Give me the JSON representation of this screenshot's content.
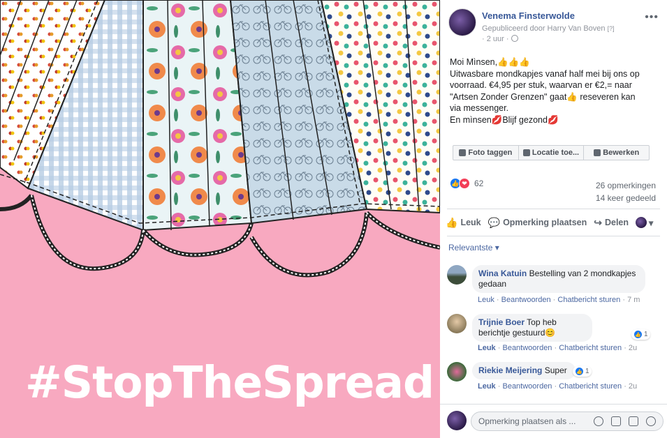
{
  "photo": {
    "hashtag": "#StopTheSpread",
    "background_color": "#f8a9c0"
  },
  "post": {
    "page_name": "Venema Finsterwolde",
    "published_by": "Gepubliceerd door Harry Van Boven",
    "help": "[?]",
    "time": "2 uur",
    "privacy_icon": "globe-icon",
    "text_lines": [
      "Moi Mìnsen,👍👍👍",
      "Uitwasbare mondkapjes vanaf half mei bij ons op",
      "voorraad. €4,95 per stuk, waarvan er €2,= naar",
      "\"Artsen Zonder Grenzen\" gaat👍 reseveren kan",
      "via messenger.",
      "En mìnsen💋Blijf gezond💋"
    ],
    "photo_actions": {
      "tag": "Foto taggen",
      "location": "Locatie toe...",
      "edit": "Bewerken"
    },
    "reaction_count": "62",
    "comments_count": "26 opmerkingen",
    "shares_count": "14 keer gedeeld",
    "actions": {
      "like": "Leuk",
      "comment": "Opmerking plaatsen",
      "share": "Delen"
    }
  },
  "comments": {
    "sort_label": "Relevantste ▾",
    "items": [
      {
        "author": "Wina Katuin",
        "text": "Bestelling van 2 mondkapjes gedaan",
        "like": "Leuk",
        "reply": "Beantwoorden",
        "message": "Chatbericht sturen",
        "time": "7 m",
        "reactions": ""
      },
      {
        "author": "Trijnie Boer",
        "text": "Top heb berichtje gestuurd😊",
        "like": "Leuk",
        "reply": "Beantwoorden",
        "message": "Chatbericht sturen",
        "time": "2u",
        "reactions": "1"
      },
      {
        "author": "Riekie Meijering",
        "text": "Super",
        "like": "Leuk",
        "reply": "Beantwoorden",
        "message": "Chatbericht sturen",
        "time": "2u",
        "reactions": "1"
      }
    ]
  },
  "composer": {
    "placeholder": "Opmerking plaatsen als ..."
  },
  "colors": {
    "link": "#385898",
    "like_blue": "#1877f2",
    "love_red": "#f33e58"
  }
}
